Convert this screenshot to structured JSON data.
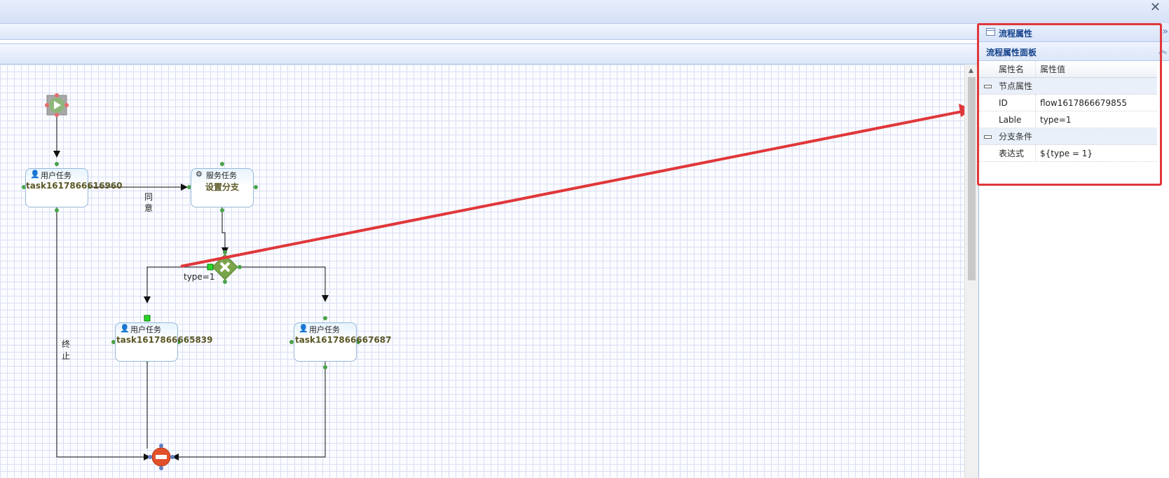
{
  "window": {
    "close_glyph": "✕"
  },
  "panel": {
    "title": "流程属性",
    "subtitle": "流程属性面板",
    "collapse_glyph": "»",
    "subtitle_glyph": "︽",
    "columns": {
      "name": "属性名",
      "value": "属性值"
    },
    "groups": [
      {
        "title": "节点属性",
        "rows": [
          {
            "name": "ID",
            "value": "flow1617866679855"
          },
          {
            "name": "Lable",
            "value": "type=1"
          }
        ]
      },
      {
        "title": "分支条件",
        "rows": [
          {
            "name": "表达式",
            "value": "${type = 1}"
          }
        ]
      }
    ]
  },
  "diagram": {
    "task1": {
      "type_label": "用户任务",
      "name": "task1617866616960"
    },
    "service": {
      "type_label": "服务任务",
      "name": "设置分支"
    },
    "task2": {
      "type_label": "用户任务",
      "name": "task1617866665839"
    },
    "task3": {
      "type_label": "用户任务",
      "name": "task1617866667687"
    },
    "flow_agree_label": [
      "同",
      "意"
    ],
    "flow_end_label": [
      "终",
      "止"
    ],
    "flow_type_label": "type=1"
  },
  "colors": {
    "highlight": "#e0373a",
    "accent": "#15428b"
  }
}
